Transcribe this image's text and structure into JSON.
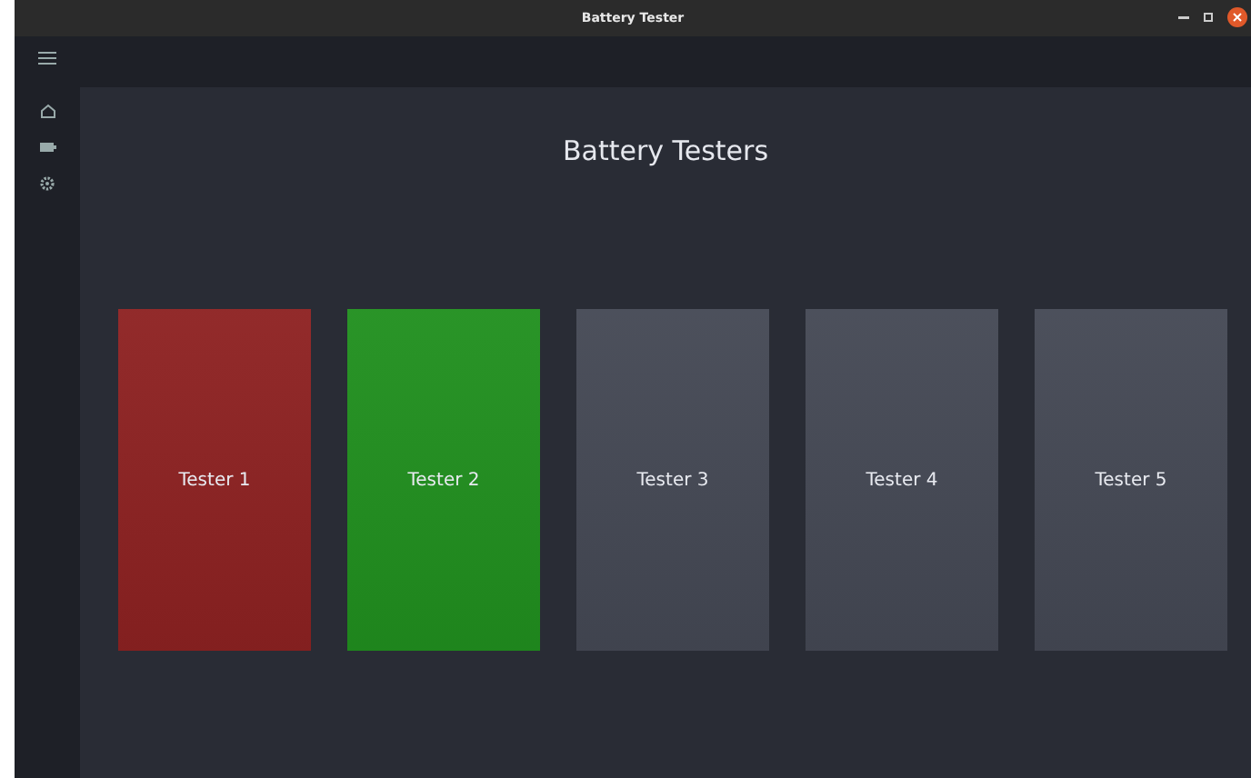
{
  "window": {
    "title": "Battery Tester"
  },
  "page": {
    "heading": "Battery Testers"
  },
  "testers": [
    {
      "label": "Tester 1",
      "color": "#8e2222"
    },
    {
      "label": "Tester 2",
      "color": "#21901f"
    },
    {
      "label": "Tester 3",
      "color": "#454955"
    },
    {
      "label": "Tester 4",
      "color": "#454955"
    },
    {
      "label": "Tester 5",
      "color": "#454955"
    }
  ]
}
